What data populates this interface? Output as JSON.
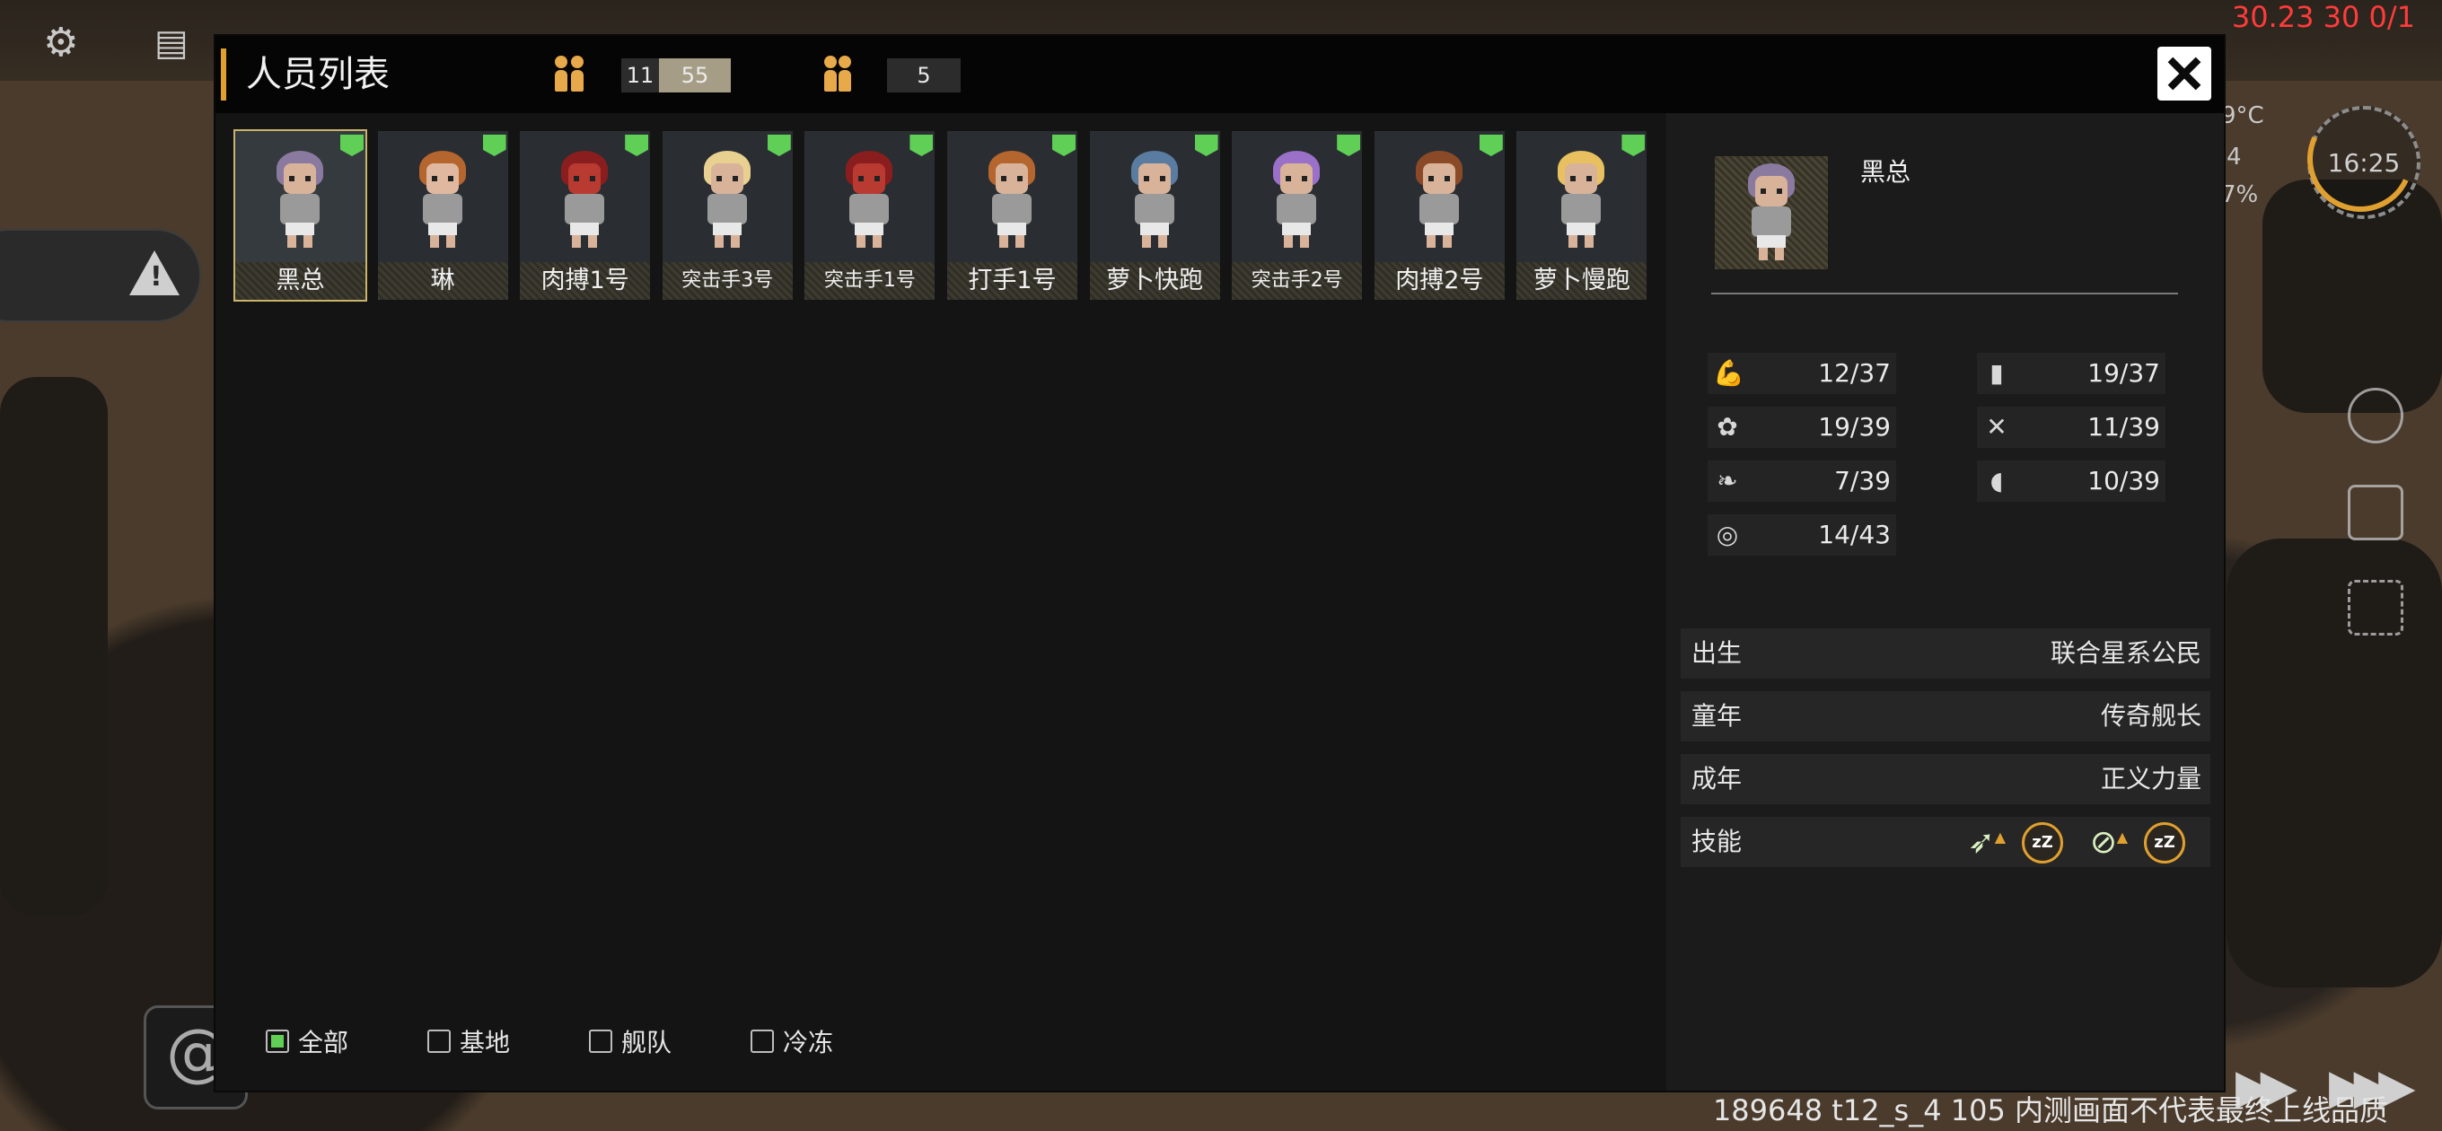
{
  "hud": {
    "debug_top": "30.23 30 0/1",
    "debug_bottom": "189648 t12_s_4 105  内测画面不代表最终上线品质",
    "clock_time": "16:25",
    "side_temp": "9°C",
    "side_line2": "4",
    "side_line3": "7%",
    "icons": [
      "gear-icon",
      "chat-icon",
      "warning-icon",
      "galaxy-icon",
      "fast-forward-icon",
      "fastest-forward-icon",
      "cube-icon",
      "clipboard-icon",
      "scan-icon"
    ]
  },
  "panel": {
    "title": "人员列表",
    "pop_current": "11",
    "pop_capacity": "55",
    "pop_other": "5",
    "close_icon": "close-icon"
  },
  "roster": [
    {
      "name": "黑总",
      "hair": "#8a7aa0",
      "face": "#d8b39a",
      "selected": true,
      "small": false
    },
    {
      "name": "琳",
      "hair": "#b5652e",
      "face": "#e0b8a0",
      "selected": false,
      "small": false
    },
    {
      "name": "肉搏1号",
      "hair": "#8a1e1e",
      "face": "#b83a30",
      "selected": false,
      "small": false
    },
    {
      "name": "突击手3号",
      "hair": "#e8d090",
      "face": "#d8b39a",
      "selected": false,
      "small": true
    },
    {
      "name": "突击手1号",
      "hair": "#8a1e1e",
      "face": "#b83a30",
      "selected": false,
      "small": true
    },
    {
      "name": "打手1号",
      "hair": "#b5652e",
      "face": "#d8b39a",
      "selected": false,
      "small": false
    },
    {
      "name": "萝卜快跑",
      "hair": "#5a7ca0",
      "face": "#d8b39a",
      "selected": false,
      "small": false
    },
    {
      "name": "突击手2号",
      "hair": "#9a70c8",
      "face": "#d8b39a",
      "selected": false,
      "small": true
    },
    {
      "name": "肉搏2号",
      "hair": "#8a4a28",
      "face": "#d8b39a",
      "selected": false,
      "small": false
    },
    {
      "name": "萝卜慢跑",
      "hair": "#e8c060",
      "face": "#d8b39a",
      "selected": false,
      "small": false
    }
  ],
  "filters": [
    {
      "label": "全部",
      "checked": true
    },
    {
      "label": "基地",
      "checked": false
    },
    {
      "label": "舰队",
      "checked": false
    },
    {
      "label": "冷冻",
      "checked": false
    }
  ],
  "detail": {
    "name": "黑总",
    "stats_left": [
      {
        "icon": "strength-icon",
        "value": "12/37"
      },
      {
        "icon": "paw-icon",
        "value": "19/39"
      },
      {
        "icon": "leaf-icon",
        "value": "7/39"
      },
      {
        "icon": "target-icon",
        "value": "14/43"
      }
    ],
    "stats_right": [
      {
        "icon": "book-icon",
        "value": "19/37"
      },
      {
        "icon": "tools-icon",
        "value": "11/39"
      },
      {
        "icon": "helmet-icon",
        "value": "10/39"
      }
    ],
    "info": [
      {
        "key": "出生",
        "value": "联合星系公民"
      },
      {
        "key": "童年",
        "value": "传奇舰长"
      },
      {
        "key": "成年",
        "value": "正义力量"
      }
    ],
    "skills_label": "技能",
    "skills": [
      "plant-up-icon",
      "sleep-icon",
      "no-plant-up-icon",
      "sleep-icon"
    ]
  }
}
